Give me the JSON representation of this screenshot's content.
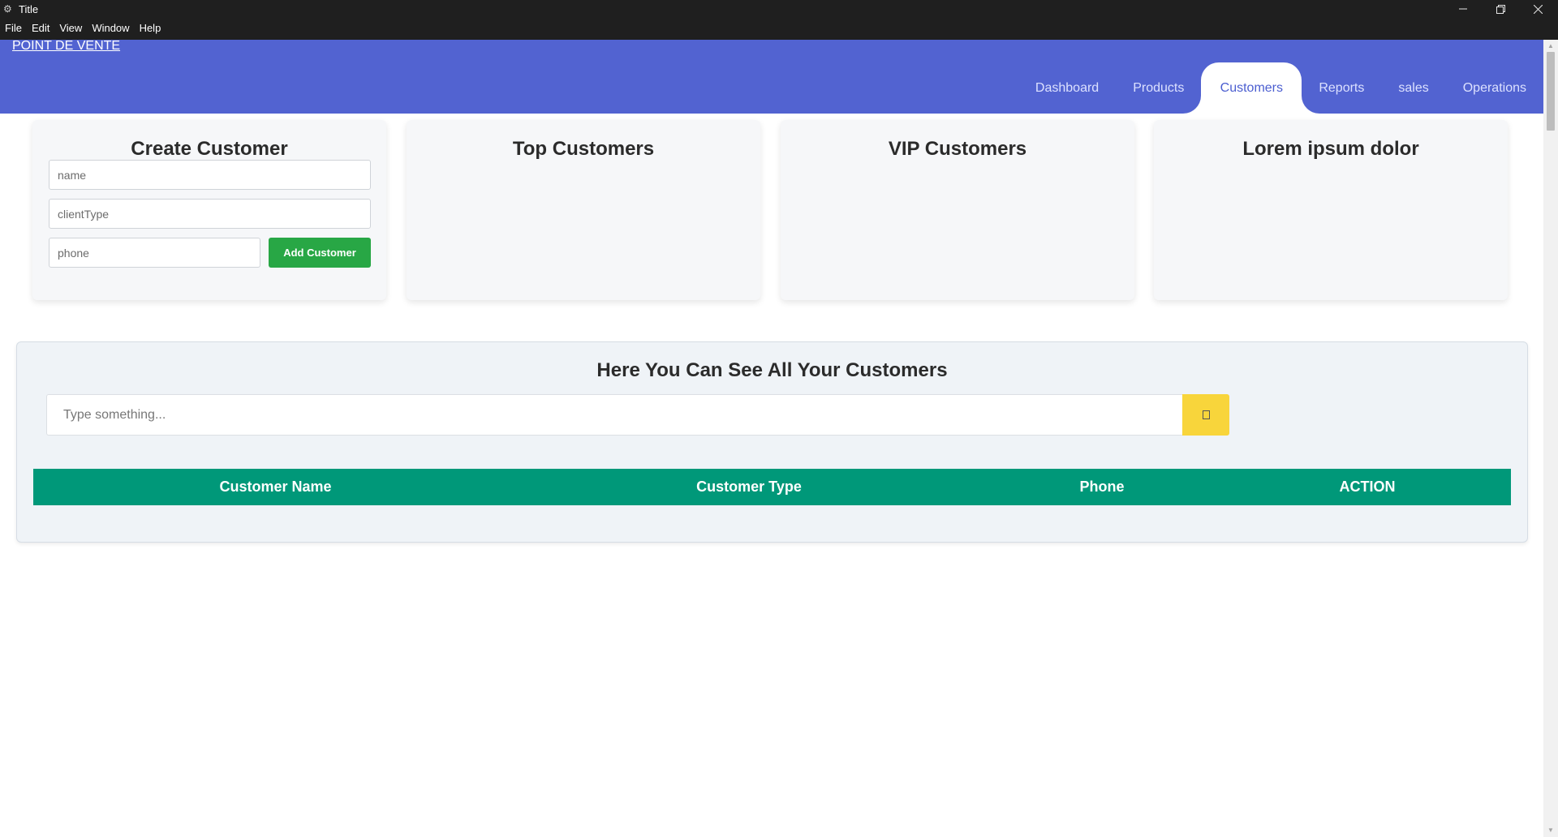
{
  "window": {
    "title": "Title",
    "app_icon": "gear-icon",
    "menu": [
      "File",
      "Edit",
      "View",
      "Window",
      "Help"
    ],
    "controls": [
      "minimize-icon",
      "maximize-icon",
      "close-icon"
    ]
  },
  "header": {
    "brand": "POINT DE VENTE",
    "tabs": [
      {
        "label": "Dashboard",
        "active": false
      },
      {
        "label": "Products",
        "active": false
      },
      {
        "label": "Customers",
        "active": true
      },
      {
        "label": "Reports",
        "active": false
      },
      {
        "label": "sales",
        "active": false
      },
      {
        "label": "Operations",
        "active": false
      }
    ],
    "colors": {
      "bar": "#5263d1",
      "active_text": "#4b5ed0"
    }
  },
  "cards": {
    "create": {
      "title": "Create Customer",
      "name_placeholder": "name",
      "client_type_placeholder": "clientType",
      "phone_placeholder": "phone",
      "add_button": "Add Customer"
    },
    "top": {
      "title": "Top Customers"
    },
    "vip": {
      "title": "VIP Customers"
    },
    "lorem": {
      "title": "Lorem ipsum dolor"
    }
  },
  "customers": {
    "title": "Here You Can See All Your Customers",
    "search_placeholder": "Type something...",
    "search_button_icon": "search-icon",
    "columns": [
      "Customer Name",
      "Customer Type",
      "Phone",
      "ACTION"
    ],
    "rows": [],
    "colors": {
      "table_header": "#009879",
      "search_button": "#f8d53b",
      "add_button": "#28a745"
    }
  }
}
